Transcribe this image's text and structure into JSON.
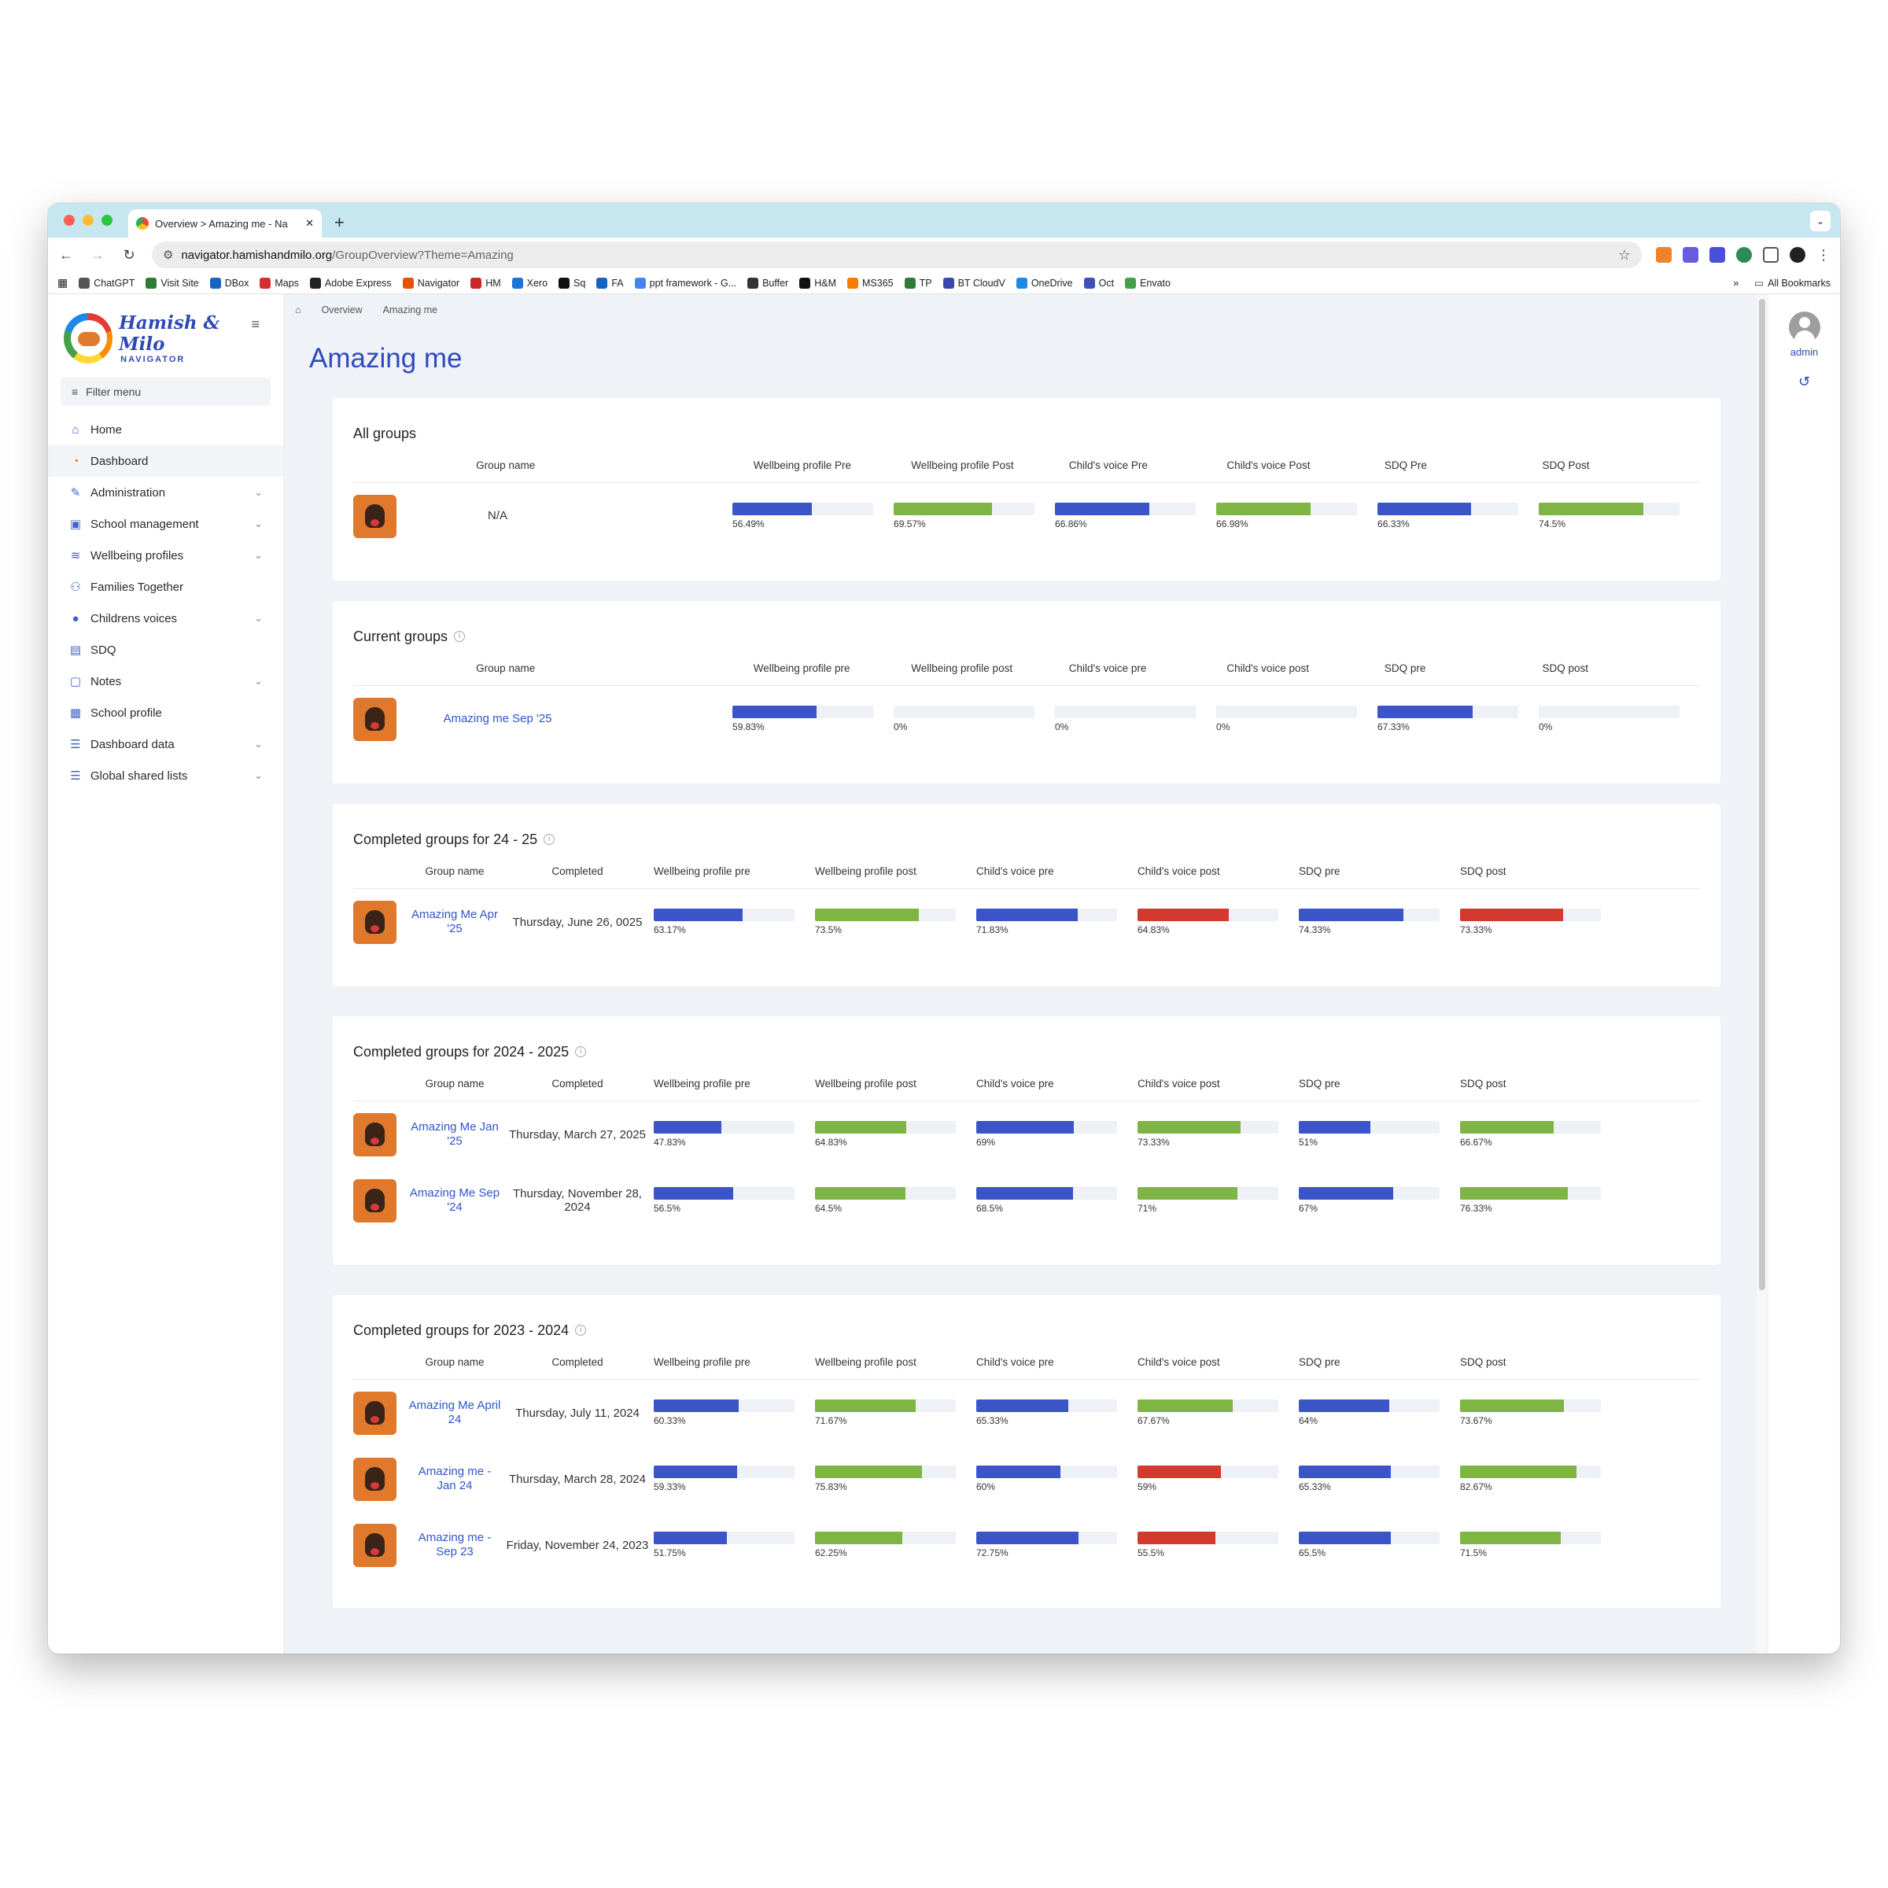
{
  "browser": {
    "tab_title": "Overview > Amazing me - Na",
    "url_host": "navigator.hamishandmilo.org",
    "url_path": "/GroupOverview?Theme=Amazing",
    "bookmarks": [
      "ChatGPT",
      "Visit Site",
      "DBox",
      "Maps",
      "Adobe Express",
      "Navigator",
      "HM",
      "Xero",
      "Sq",
      "FA",
      "ppt framework - G...",
      "Buffer",
      "H&M",
      "MS365",
      "TP",
      "BT CloudV",
      "OneDrive",
      "Oct",
      "Envato"
    ],
    "all_bookmarks": "All Bookmarks"
  },
  "sidebar": {
    "logo_name": "Hamish & Milo",
    "logo_sub": "NAVIGATOR",
    "filter_placeholder": "Filter menu",
    "items": [
      {
        "label": "Home",
        "icon": "home-icon",
        "glyph": "⌂",
        "chevron": false
      },
      {
        "label": "Dashboard",
        "icon": "pie-chart-icon",
        "glyph": "◔",
        "chevron": false,
        "active": true
      },
      {
        "label": "Administration",
        "icon": "wrench-icon",
        "glyph": "✎",
        "chevron": true
      },
      {
        "label": "School management",
        "icon": "school-icon",
        "glyph": "▣",
        "chevron": true
      },
      {
        "label": "Wellbeing profiles",
        "icon": "sliders-icon",
        "glyph": "≋",
        "chevron": true
      },
      {
        "label": "Families Together",
        "icon": "family-icon",
        "glyph": "⚇",
        "chevron": false
      },
      {
        "label": "Childrens voices",
        "icon": "speech-bubble-icon",
        "glyph": "●",
        "chevron": true
      },
      {
        "label": "SDQ",
        "icon": "document-icon",
        "glyph": "▤",
        "chevron": false
      },
      {
        "label": "Notes",
        "icon": "note-icon",
        "glyph": "▢",
        "chevron": true
      },
      {
        "label": "School profile",
        "icon": "building-icon",
        "glyph": "▦",
        "chevron": false
      },
      {
        "label": "Dashboard data",
        "icon": "list-icon",
        "glyph": "☰",
        "chevron": true
      },
      {
        "label": "Global shared lists",
        "icon": "list-icon",
        "glyph": "☰",
        "chevron": true
      }
    ]
  },
  "breadcrumb": {
    "home_icon": "home-icon",
    "items": [
      "Overview",
      "Amazing me"
    ]
  },
  "page_title": "Amazing me",
  "user": {
    "label": "admin"
  },
  "colors": {
    "blue": "#3b55c8",
    "green": "#7fb543",
    "red": "#d3392e"
  },
  "sections": [
    {
      "title": "All groups",
      "info": false,
      "has_completed": false,
      "headers": [
        "Group name",
        "Wellbeing profile Pre",
        "Wellbeing profile Post",
        "Child's voice Pre",
        "Child's voice Post",
        "SDQ Pre",
        "SDQ Post"
      ],
      "rows": [
        {
          "name": "N/A",
          "link": false,
          "completed": "",
          "metrics": [
            {
              "value": 56.49,
              "label": "56.49%",
              "color": "blue"
            },
            {
              "value": 69.57,
              "label": "69.57%",
              "color": "green"
            },
            {
              "value": 66.86,
              "label": "66.86%",
              "color": "blue"
            },
            {
              "value": 66.98,
              "label": "66.98%",
              "color": "green"
            },
            {
              "value": 66.33,
              "label": "66.33%",
              "color": "blue"
            },
            {
              "value": 74.5,
              "label": "74.5%",
              "color": "green"
            }
          ]
        }
      ]
    },
    {
      "title": "Current groups",
      "info": true,
      "has_completed": false,
      "headers": [
        "Group name",
        "Wellbeing profile pre",
        "Wellbeing profile post",
        "Child's voice pre",
        "Child's voice post",
        "SDQ pre",
        "SDQ post"
      ],
      "rows": [
        {
          "name": "Amazing me Sep '25",
          "link": true,
          "completed": "",
          "metrics": [
            {
              "value": 59.83,
              "label": "59.83%",
              "color": "blue"
            },
            {
              "value": 0,
              "label": "0%",
              "color": "green"
            },
            {
              "value": 0,
              "label": "0%",
              "color": "blue"
            },
            {
              "value": 0,
              "label": "0%",
              "color": "green"
            },
            {
              "value": 67.33,
              "label": "67.33%",
              "color": "blue"
            },
            {
              "value": 0,
              "label": "0%",
              "color": "green"
            }
          ]
        }
      ]
    },
    {
      "title": "Completed groups for 24 - 25",
      "info": true,
      "has_completed": true,
      "headers": [
        "Group name",
        "Completed",
        "Wellbeing profile pre",
        "Wellbeing profile post",
        "Child's voice pre",
        "Child's voice post",
        "SDQ pre",
        "SDQ post"
      ],
      "rows": [
        {
          "name": "Amazing Me Apr '25",
          "link": true,
          "completed": "Thursday, June 26, 0025",
          "metrics": [
            {
              "value": 63.17,
              "label": "63.17%",
              "color": "blue"
            },
            {
              "value": 73.5,
              "label": "73.5%",
              "color": "green"
            },
            {
              "value": 71.83,
              "label": "71.83%",
              "color": "blue"
            },
            {
              "value": 64.83,
              "label": "64.83%",
              "color": "red"
            },
            {
              "value": 74.33,
              "label": "74.33%",
              "color": "blue"
            },
            {
              "value": 73.33,
              "label": "73.33%",
              "color": "red"
            }
          ]
        }
      ]
    },
    {
      "title": "Completed groups for 2024 - 2025",
      "info": true,
      "has_completed": true,
      "headers": [
        "Group name",
        "Completed",
        "Wellbeing profile pre",
        "Wellbeing profile post",
        "Child's voice pre",
        "Child's voice post",
        "SDQ pre",
        "SDQ post"
      ],
      "rows": [
        {
          "name": "Amazing Me Jan '25",
          "link": true,
          "completed": "Thursday, March 27, 2025",
          "metrics": [
            {
              "value": 47.83,
              "label": "47.83%",
              "color": "blue"
            },
            {
              "value": 64.83,
              "label": "64.83%",
              "color": "green"
            },
            {
              "value": 69,
              "label": "69%",
              "color": "blue"
            },
            {
              "value": 73.33,
              "label": "73.33%",
              "color": "green"
            },
            {
              "value": 51,
              "label": "51%",
              "color": "blue"
            },
            {
              "value": 66.67,
              "label": "66.67%",
              "color": "green"
            }
          ]
        },
        {
          "name": "Amazing Me Sep '24",
          "link": true,
          "completed": "Thursday, November 28, 2024",
          "metrics": [
            {
              "value": 56.5,
              "label": "56.5%",
              "color": "blue"
            },
            {
              "value": 64.5,
              "label": "64.5%",
              "color": "green"
            },
            {
              "value": 68.5,
              "label": "68.5%",
              "color": "blue"
            },
            {
              "value": 71,
              "label": "71%",
              "color": "green"
            },
            {
              "value": 67,
              "label": "67%",
              "color": "blue"
            },
            {
              "value": 76.33,
              "label": "76.33%",
              "color": "green"
            }
          ]
        }
      ]
    },
    {
      "title": "Completed groups for 2023 - 2024",
      "info": true,
      "has_completed": true,
      "headers": [
        "Group name",
        "Completed",
        "Wellbeing profile pre",
        "Wellbeing profile post",
        "Child's voice pre",
        "Child's voice post",
        "SDQ pre",
        "SDQ post"
      ],
      "rows": [
        {
          "name": "Amazing Me April 24",
          "link": true,
          "completed": "Thursday, July 11, 2024",
          "metrics": [
            {
              "value": 60.33,
              "label": "60.33%",
              "color": "blue"
            },
            {
              "value": 71.67,
              "label": "71.67%",
              "color": "green"
            },
            {
              "value": 65.33,
              "label": "65.33%",
              "color": "blue"
            },
            {
              "value": 67.67,
              "label": "67.67%",
              "color": "green"
            },
            {
              "value": 64,
              "label": "64%",
              "color": "blue"
            },
            {
              "value": 73.67,
              "label": "73.67%",
              "color": "green"
            }
          ]
        },
        {
          "name": "Amazing me - Jan 24",
          "link": true,
          "completed": "Thursday, March 28, 2024",
          "metrics": [
            {
              "value": 59.33,
              "label": "59.33%",
              "color": "blue"
            },
            {
              "value": 75.83,
              "label": "75.83%",
              "color": "green"
            },
            {
              "value": 60,
              "label": "60%",
              "color": "blue"
            },
            {
              "value": 59,
              "label": "59%",
              "color": "red"
            },
            {
              "value": 65.33,
              "label": "65.33%",
              "color": "blue"
            },
            {
              "value": 82.67,
              "label": "82.67%",
              "color": "green"
            }
          ]
        },
        {
          "name": "Amazing me - Sep 23",
          "link": true,
          "completed": "Friday, November 24, 2023",
          "metrics": [
            {
              "value": 51.75,
              "label": "51.75%",
              "color": "blue"
            },
            {
              "value": 62.25,
              "label": "62.25%",
              "color": "green"
            },
            {
              "value": 72.75,
              "label": "72.75%",
              "color": "blue"
            },
            {
              "value": 55.5,
              "label": "55.5%",
              "color": "red"
            },
            {
              "value": 65.5,
              "label": "65.5%",
              "color": "blue"
            },
            {
              "value": 71.5,
              "label": "71.5%",
              "color": "green"
            }
          ]
        }
      ]
    }
  ]
}
